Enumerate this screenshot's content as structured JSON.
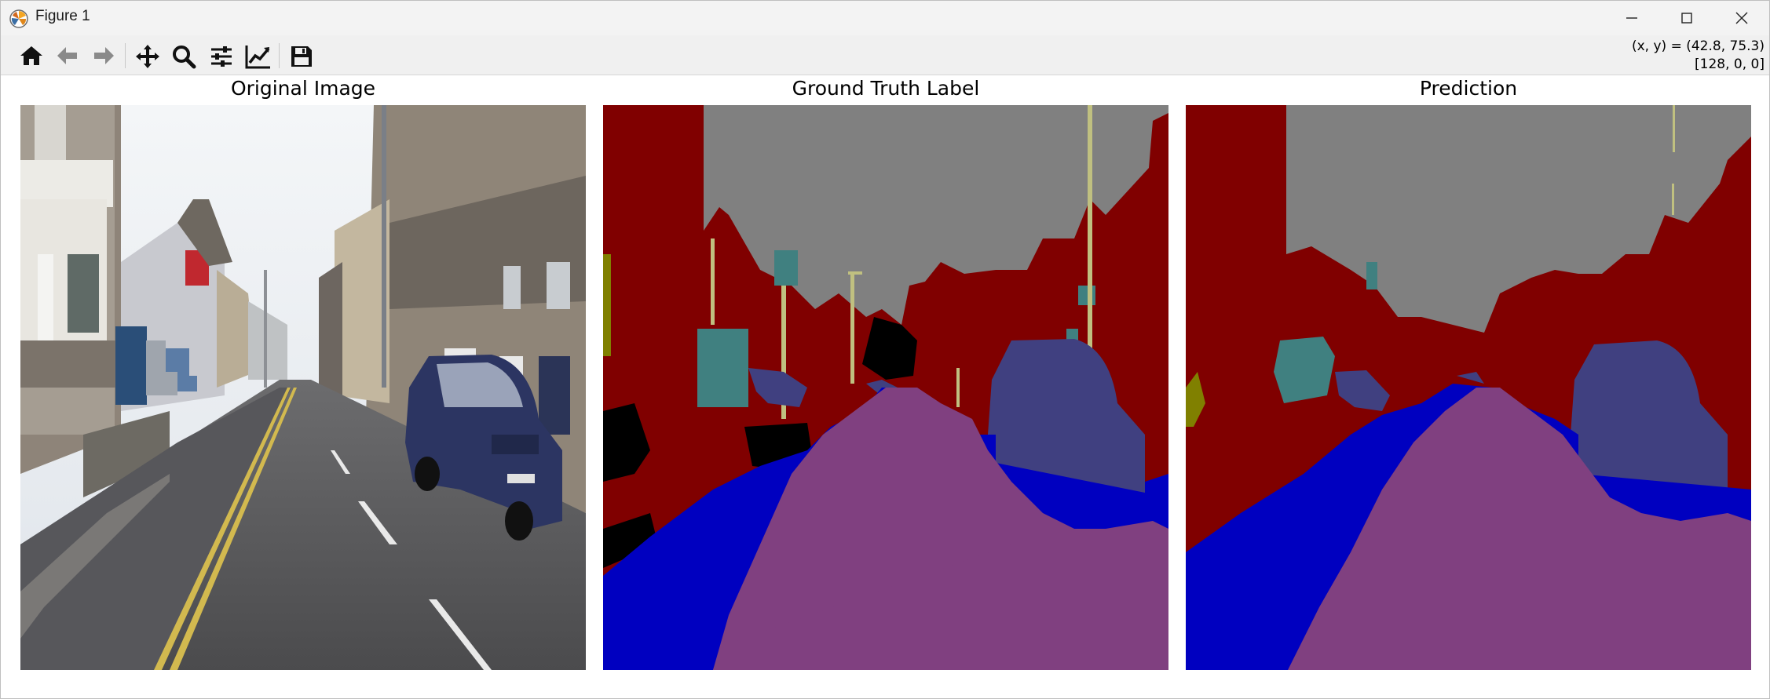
{
  "window": {
    "title": "Figure 1",
    "controls": [
      "minimize",
      "maximize",
      "close"
    ]
  },
  "toolbar": {
    "buttons": [
      {
        "name": "home",
        "icon": "home-icon"
      },
      {
        "name": "back",
        "icon": "arrow-left-icon"
      },
      {
        "name": "forward",
        "icon": "arrow-right-icon"
      },
      {
        "name": "pan",
        "icon": "move-icon"
      },
      {
        "name": "zoom",
        "icon": "magnifier-icon"
      },
      {
        "name": "configure-subplots",
        "icon": "sliders-icon"
      },
      {
        "name": "edit-axis",
        "icon": "line-chart-icon"
      },
      {
        "name": "save",
        "icon": "floppy-disk-icon"
      }
    ],
    "coords_line1": "(x, y) = (42.8, 75.3)",
    "coords_line2": "[128, 0, 0]"
  },
  "figure": {
    "panels": [
      {
        "title": "Original Image"
      },
      {
        "title": "Ground Truth Label"
      },
      {
        "title": "Prediction"
      }
    ]
  },
  "colors": {
    "sky": "#808080",
    "building": "#800000",
    "pole": "#c0c080",
    "road": "#804080",
    "sidewalk": "#0000c0",
    "car": "#404080",
    "sign": "#408080",
    "fence": "#808000",
    "void": "#000000"
  }
}
